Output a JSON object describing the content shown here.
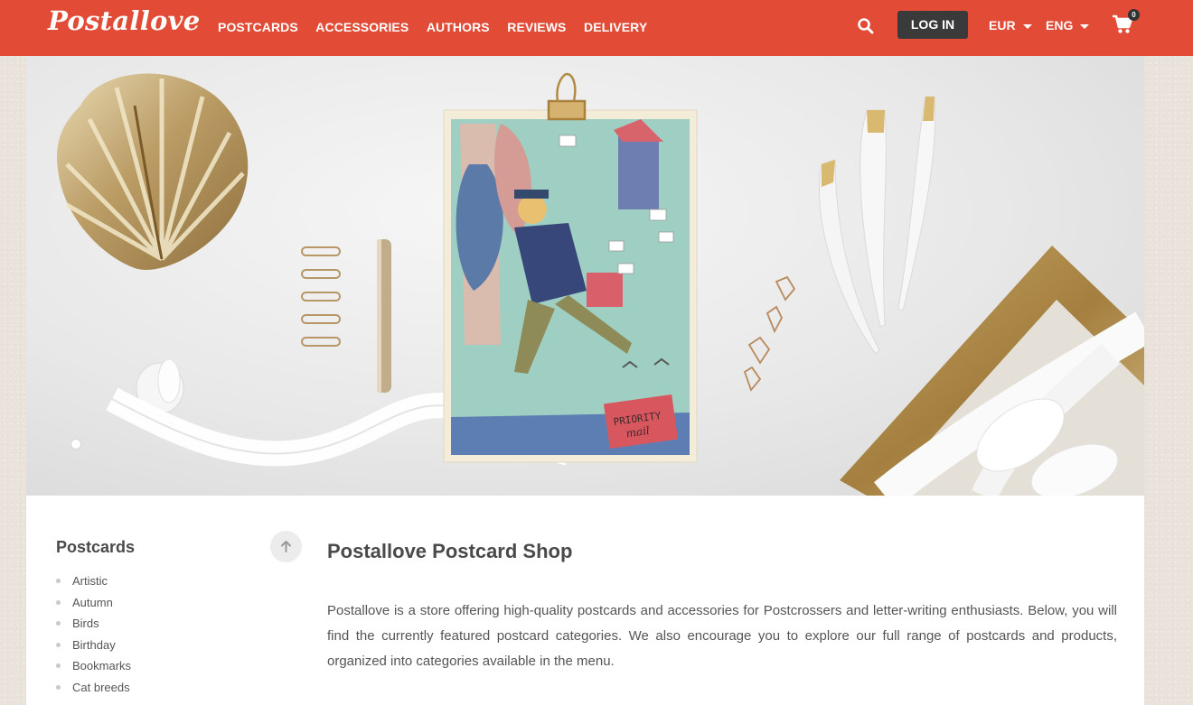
{
  "header": {
    "logo": "Postallove",
    "nav": [
      "POSTCARDS",
      "ACCESSORIES",
      "AUTHORS",
      "REVIEWS",
      "DELIVERY"
    ],
    "login_label": "LOG IN",
    "currency": "EUR",
    "language": "ENG",
    "cart_count": "0",
    "icons": {
      "search": "search-icon",
      "cart": "cart-icon"
    },
    "colors": {
      "brand": "#e24b36",
      "login_bg": "#3a3a3a"
    }
  },
  "hero": {
    "postcard_stamp": [
      "PRIORITY",
      "mail"
    ],
    "slides": 1,
    "active_slide": 1
  },
  "sidebar": {
    "title": "Postcards",
    "items": [
      "Artistic",
      "Autumn",
      "Birds",
      "Birthday",
      "Bookmarks",
      "Cat breeds"
    ]
  },
  "main": {
    "title": "Postallove Postcard Shop",
    "intro": "Postallove is a store offering high-quality postcards and accessories for Postcrossers and letter-writing enthusiasts. Below, you will find the currently featured postcard categories. We also encourage you to explore our full range of postcards and products, organized into categories available in the menu."
  }
}
